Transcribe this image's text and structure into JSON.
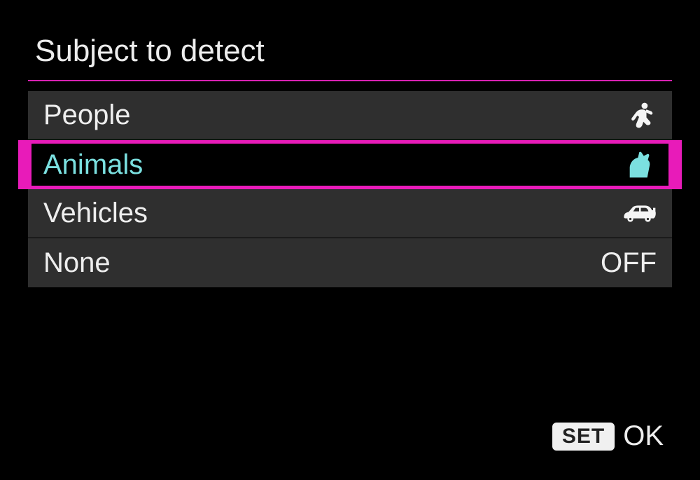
{
  "title": "Subject to detect",
  "options": [
    {
      "label": "People",
      "icon": "person-running-icon",
      "selected": false
    },
    {
      "label": "Animals",
      "icon": "cat-icon",
      "selected": true
    },
    {
      "label": "Vehicles",
      "icon": "car-icon",
      "selected": false
    },
    {
      "label": "None",
      "icon": "",
      "selected": false,
      "off_label": "OFF"
    }
  ],
  "footer": {
    "set_label": "SET",
    "ok_label": "OK"
  },
  "colors": {
    "accent": "#e81bb9",
    "selected_text": "#7be0e0"
  }
}
